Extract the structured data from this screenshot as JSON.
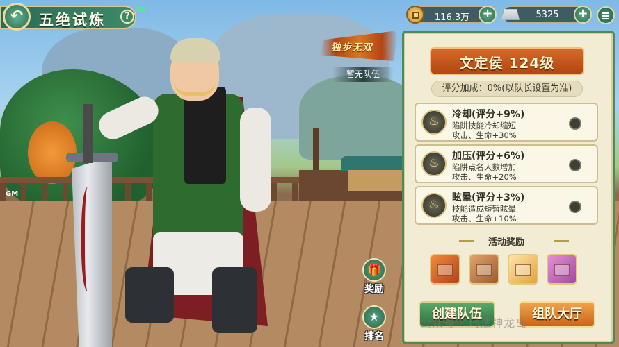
{
  "header": {
    "title": "五绝试炼",
    "back_icon": "back-arrow-icon",
    "help_label": "?",
    "fps": "58"
  },
  "currencies": [
    {
      "icon": "coin-icon",
      "value": "116.3万",
      "add_label": "+"
    },
    {
      "icon": "silver-ingot-icon",
      "value": "5325",
      "add_label": "+"
    }
  ],
  "scene": {
    "badge_text": "独步无双",
    "team_status": "暂无队伍",
    "gm_tag": "GM"
  },
  "side_actions": [
    {
      "label": "奖励",
      "icon": "gift-icon",
      "glyph": "🎁"
    },
    {
      "label": "排名",
      "icon": "rank-icon",
      "glyph": "★"
    }
  ],
  "panel": {
    "title": "文定侯 124级",
    "score_bonus": "评分加成：0%(以队长设置为准)",
    "buffs": [
      {
        "name": "冷却(评分+9%)",
        "desc1": "陷阱技能冷却缩短",
        "desc2": "攻击、生命+30%",
        "icon": "flame-emblem-icon"
      },
      {
        "name": "加压(评分+6%)",
        "desc1": "陷阱点名人数增加",
        "desc2": "攻击、生命+20%",
        "icon": "flame-emblem-icon"
      },
      {
        "name": "眩晕(评分+3%)",
        "desc1": "技能造成短暂眩晕",
        "desc2": "攻击、生命+10%",
        "icon": "flame-emblem-icon"
      }
    ],
    "reward_title": "活动奖励",
    "rewards": [
      {
        "icon": "red-chest-icon"
      },
      {
        "icon": "wooden-chest-icon"
      },
      {
        "icon": "gold-gift-box-icon"
      },
      {
        "icon": "cake-icon"
      }
    ],
    "create_team_label": "创建队伍",
    "team_hall_label": "组队大厅"
  },
  "watermark": "公众号 · 玛法神龙岛",
  "colors": {
    "panel_border": "#4c8a5c",
    "panel_bg": "#f2ecd5",
    "header_orange": "#d56a2b",
    "create_green": "#2d7141",
    "hall_orange": "#c9651a"
  }
}
